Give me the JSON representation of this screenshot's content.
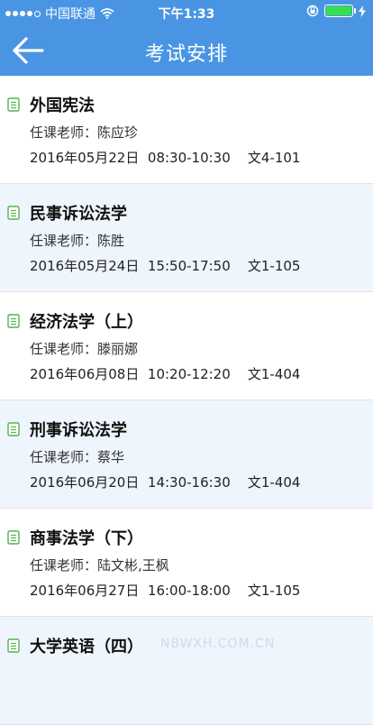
{
  "status_bar": {
    "carrier": "中国联通",
    "time": "下午1:33",
    "signal_bars": 4,
    "signal_total": 5,
    "battery_color": "#37e04a"
  },
  "nav": {
    "title": "考试安排",
    "back_icon": "arrow-left-icon",
    "background": "#4a95e3"
  },
  "exams": [
    {
      "course": "外国宪法",
      "teacher": "任课老师：陈应珍",
      "date": "2016年05月22日",
      "time": "08:30-10:30",
      "room": "文4-101"
    },
    {
      "course": "民事诉讼法学",
      "teacher": "任课老师：陈胜",
      "date": "2016年05月24日",
      "time": "15:50-17:50",
      "room": "文1-105"
    },
    {
      "course": "经济法学（上）",
      "teacher": "任课老师：滕丽娜",
      "date": "2016年06月08日",
      "time": "10:20-12:20",
      "room": "文1-404"
    },
    {
      "course": "刑事诉讼法学",
      "teacher": "任课老师：蔡华",
      "date": "2016年06月20日",
      "time": "14:30-16:30",
      "room": "文1-404"
    },
    {
      "course": "商事法学（下）",
      "teacher": "任课老师：陆文彬,王枫",
      "date": "2016年06月27日",
      "time": "16:00-18:00",
      "room": "文1-105"
    },
    {
      "course": "大学英语（四）",
      "teacher": "",
      "date": "",
      "time": "",
      "room": ""
    }
  ],
  "watermark": "NBWXH.COM.CN"
}
